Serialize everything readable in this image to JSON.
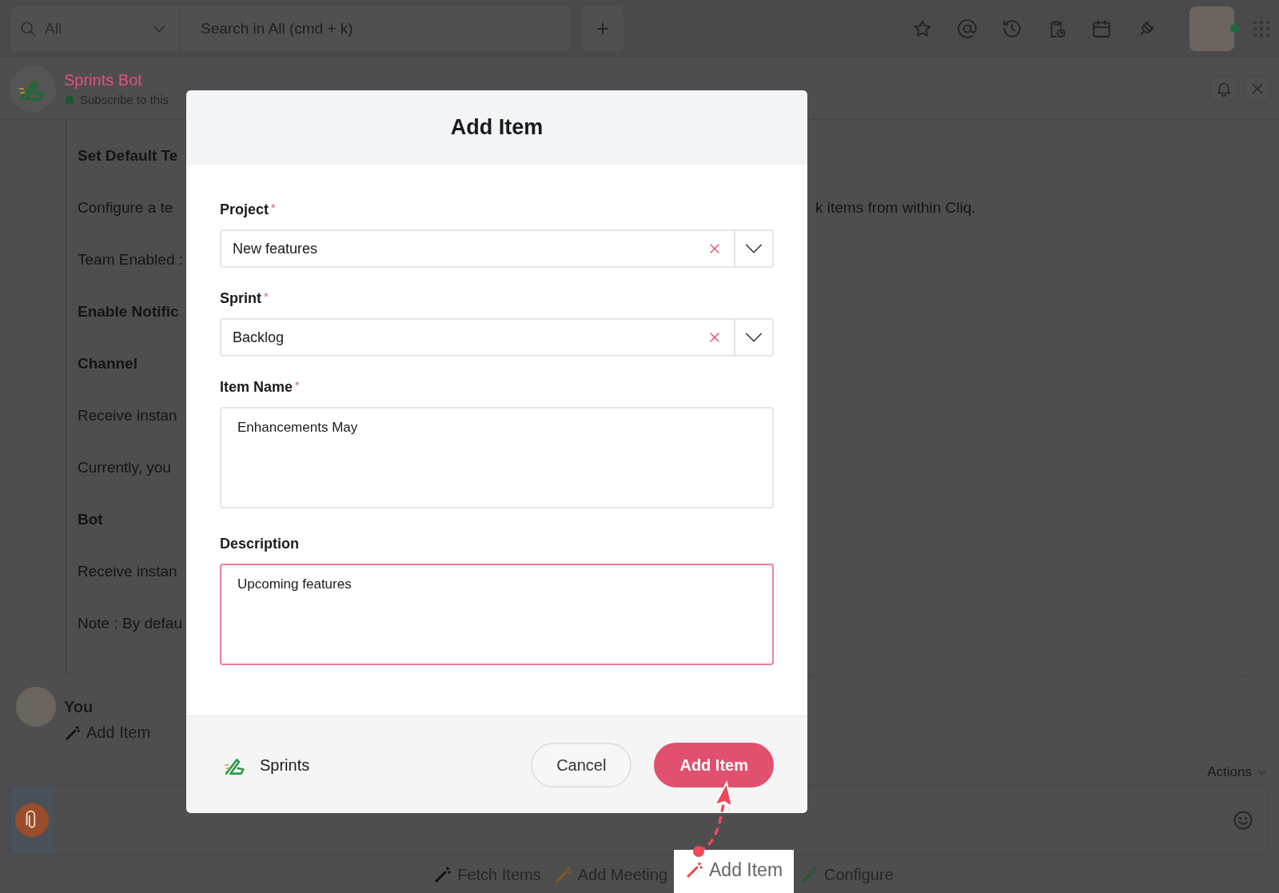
{
  "top_bar": {
    "scope": "All",
    "search": {
      "placeholder": "Search in All (cmd + k)"
    }
  },
  "chat_header": {
    "title": "Sprints Bot",
    "subtitle": "Subscribe to this"
  },
  "content": {
    "lines": [
      {
        "text": "Set Default Te",
        "kind": "heading"
      },
      {
        "text": "Configure a te",
        "kind": "body"
      },
      {
        "text": "Team Enabled :",
        "kind": "body"
      },
      {
        "text": "Enable Notific",
        "kind": "heading"
      },
      {
        "text": "Channel",
        "kind": "heading"
      },
      {
        "text": "Receive instan",
        "kind": "body"
      },
      {
        "text": "Currently, you",
        "kind": "body"
      },
      {
        "text": "Bot",
        "kind": "heading"
      },
      {
        "text": "Receive instan",
        "kind": "body"
      },
      {
        "text": "Note : By defau",
        "kind": "body"
      }
    ],
    "trailing_text": "k items from within Cliq."
  },
  "dialog": {
    "title": "Add Item",
    "fields": [
      {
        "label": "Project",
        "required_mark": "*",
        "kind": "select",
        "value": "New features",
        "focused": false
      },
      {
        "label": "Sprint",
        "required_mark": "*",
        "kind": "select",
        "value": "Backlog",
        "focused": false
      },
      {
        "label": "Item Name",
        "required_mark": "*",
        "kind": "textarea",
        "value": "Enhancements May",
        "focused": false
      },
      {
        "label": "Description",
        "kind": "textarea",
        "value": "Upcoming features",
        "focused": true
      }
    ],
    "app_name": "Sprints",
    "buttons": [
      {
        "label": "Cancel",
        "primary": false
      },
      {
        "label": "Add Item",
        "primary": true
      }
    ]
  },
  "message": {
    "sender": "You",
    "action": "Add Item"
  },
  "actions_menu": "Actions",
  "bot_actions": [
    {
      "label": "Fetch Items",
      "color": "#111111",
      "highlighted": false
    },
    {
      "label": "Add Meeting",
      "color": "#8a5a1c",
      "highlighted": false
    },
    {
      "label": "Add Item",
      "color": "#e8473f",
      "highlighted": true
    },
    {
      "label": "Configure",
      "color": "#1f5a33",
      "highlighted": false
    }
  ]
}
